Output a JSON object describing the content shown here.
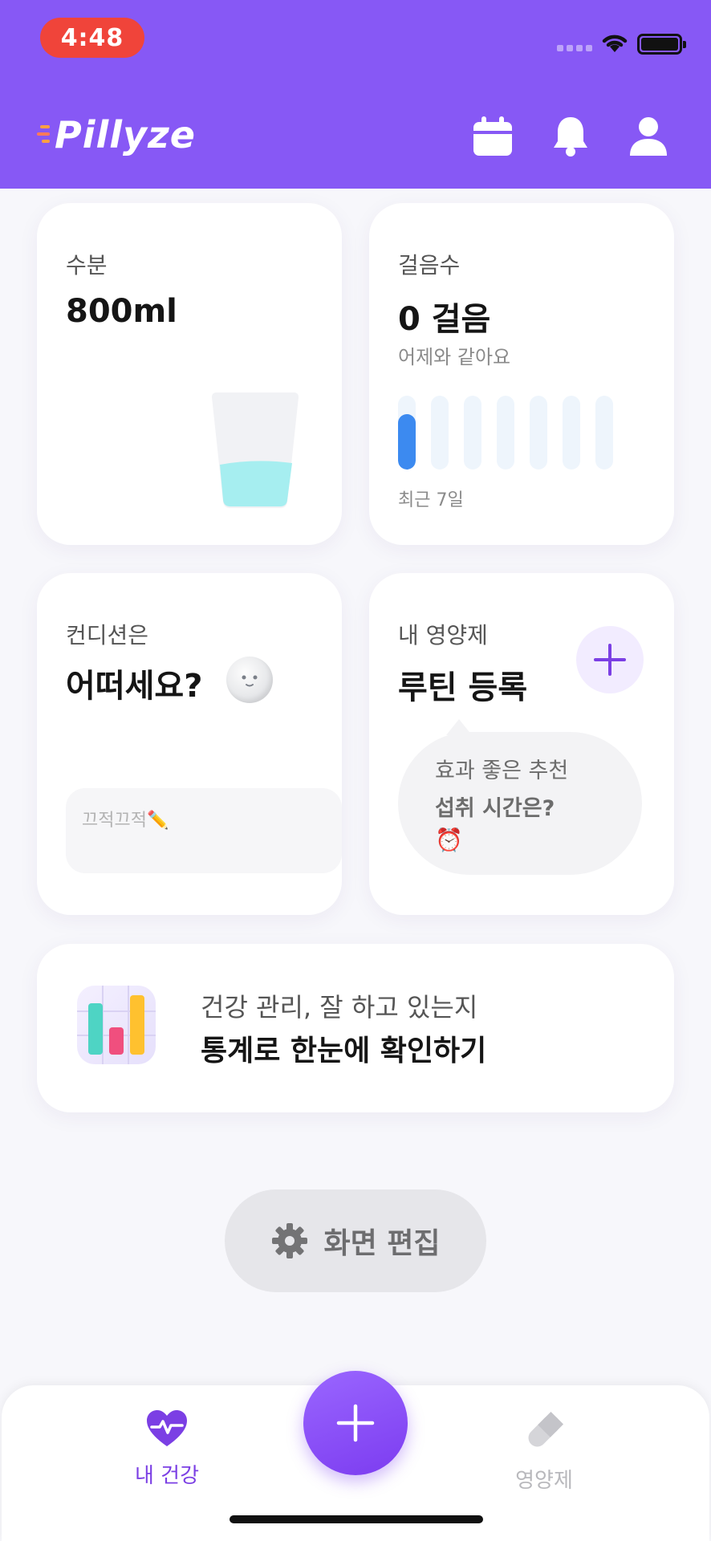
{
  "status_bar": {
    "time": "4:48"
  },
  "header": {
    "logo": "Pillyze",
    "icons": [
      "calendar-icon",
      "bell-icon",
      "profile-icon"
    ]
  },
  "cards": {
    "water": {
      "label": "수분",
      "value": "800ml"
    },
    "steps": {
      "label": "걸음수",
      "value": "0 걸음",
      "comparison": "어제와 같아요",
      "period": "최근 7일",
      "daily_levels": [
        0.75,
        0,
        0,
        0,
        0,
        0,
        0
      ]
    },
    "condition": {
      "label": "컨디션은",
      "question": "어떠세요?",
      "memo_placeholder": "끄적끄적✏️"
    },
    "supplements": {
      "label": "내 영양제",
      "title": "루틴 등록",
      "bubble_line1": "효과 좋은 추천",
      "bubble_line2": "섭취 시간은?",
      "bubble_emoji": "⏰"
    },
    "stats": {
      "line1": "건강 관리, 잘 하고 있는지",
      "line2": "통계로 한눈에 확인하기"
    }
  },
  "edit_button": {
    "label": "화면 편집"
  },
  "bottom_nav": {
    "items": [
      {
        "label": "내 건강",
        "icon": "heart-pulse-icon",
        "active": true
      },
      {
        "label": "영양제",
        "icon": "pill-icon",
        "active": false
      }
    ]
  },
  "colors": {
    "primary": "#8758f5",
    "active_nav": "#7b3fe4",
    "inactive_nav": "#b8b8bc",
    "steps_bar": "#3c8af0",
    "water": "#a6eef0"
  }
}
